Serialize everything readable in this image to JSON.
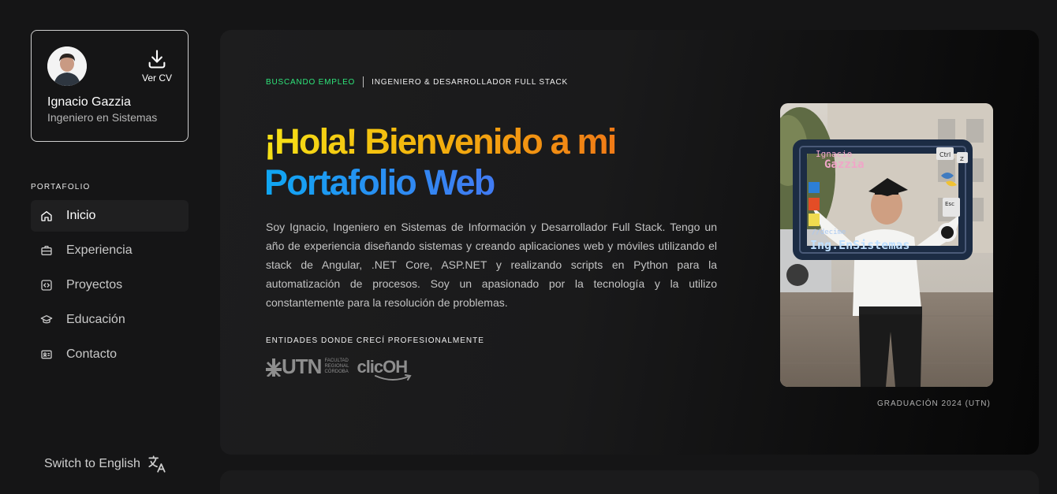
{
  "profile": {
    "name": "Ignacio Gazzia",
    "role": "Ingeniero en Sistemas",
    "cv_label": "Ver CV"
  },
  "nav": {
    "heading": "PORTAFOLIO",
    "items": [
      {
        "label": "Inicio",
        "icon": "home-icon",
        "active": true
      },
      {
        "label": "Experiencia",
        "icon": "briefcase-icon",
        "active": false
      },
      {
        "label": "Proyectos",
        "icon": "code-icon",
        "active": false
      },
      {
        "label": "Educación",
        "icon": "graduation-cap-icon",
        "active": false
      },
      {
        "label": "Contacto",
        "icon": "contact-card-icon",
        "active": false
      }
    ]
  },
  "lang_switch": {
    "label": "Switch to English",
    "icon": "translate-icon"
  },
  "hero": {
    "status": "BUSCANDO EMPLEO",
    "role": "INGENIERO & DESARROLLADOR FULL STACK",
    "headline_1": "¡Hola! Bienvenido a mi",
    "headline_2": "Portafolio Web",
    "intro": "Soy Ignacio, Ingeniero en Sistemas de Información y Desarrollador Full Stack. Tengo un año de experiencia diseñando sistemas y creando aplicaciones web y móviles utilizando el stack de Angular, .NET Core, ASP.NET y realizando scripts en Python para la automatización de procesos. Soy un apasionado por la tecnología y la utilizo constantemente para la resolución de problemas.",
    "entities_heading": "ENTIDADES DONDE CRECÍ PROFESIONALMENTE",
    "logos": {
      "utn": "UTN",
      "utn_sub_1": "FACULTAD",
      "utn_sub_2": "REGIONAL",
      "utn_sub_3": "CÓRDOBA",
      "clicoh": "clicOH"
    },
    "photo_sign": {
      "line_1": "Ignacio",
      "line_2": "Gazzia",
      "line_3": "//decime",
      "line_4": "Ing.EnSistemas",
      "ctrl": "Ctrl",
      "z": "Z",
      "esc": "Esc"
    },
    "caption": "GRADUACIÓN 2024 (UTN)"
  },
  "colors": {
    "status_green": "#2ee47a",
    "headline_yellow": "#f6e217",
    "headline_orange": "#f07a16",
    "headline_blue": "#0fa6f2"
  }
}
